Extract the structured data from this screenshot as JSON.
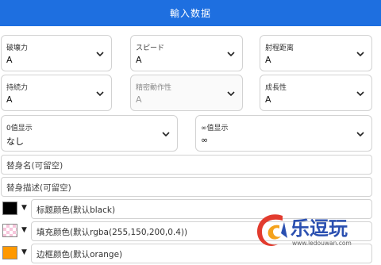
{
  "header": {
    "title": "輸入数据"
  },
  "selects": [
    {
      "label": "破壊力",
      "value": "A"
    },
    {
      "label": "スピード",
      "value": "A"
    },
    {
      "label": "射程距离",
      "value": "A"
    },
    {
      "label": "持続力",
      "value": "A"
    },
    {
      "label": "精密動作性",
      "value": "A"
    },
    {
      "label": "成長性",
      "value": "A"
    },
    {
      "label": "0值显示",
      "value": "なし"
    },
    {
      "label": "∞值显示",
      "value": "∞"
    }
  ],
  "inputs": {
    "stand_name_placeholder": "替身名(可留空)",
    "stand_desc_placeholder": "替身描述(可留空)"
  },
  "colors": {
    "title_color": {
      "label": "标题颜色(默认black)",
      "swatch": "#000000"
    },
    "fill_color": {
      "label": "填充颜色(默认rgba(255,150,200,0.4))",
      "swatch": "rgba(255,150,200,0.4)"
    },
    "border_color": {
      "label": "边框颜色(默认orange)",
      "swatch": "#ff9900"
    }
  },
  "watermark": {
    "brand": "乐逗玩",
    "url": "www.ledouwan.com"
  },
  "theme": {
    "accent": "#1e6fe0"
  }
}
